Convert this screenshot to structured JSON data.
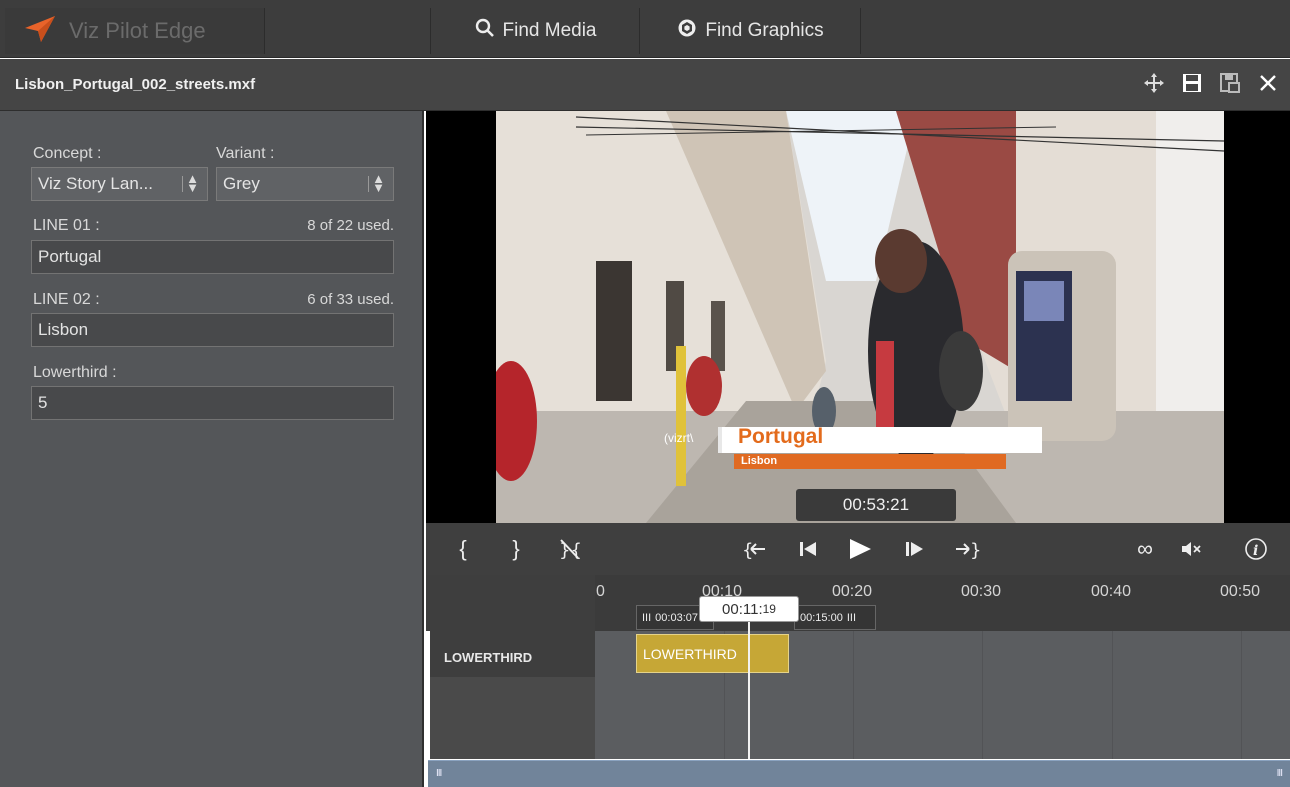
{
  "colors": {
    "accent_orange": "#e8632a",
    "clip_gold": "#c6a736",
    "panel_bg": "#545659",
    "nav_bg": "#3d3d3d",
    "lower_third_orange": "#e06a22",
    "scrollbar_blue": "#71849a"
  },
  "topnav": {
    "brand": "Viz Pilot Edge",
    "find_media": "Find Media",
    "find_graphics": "Find Graphics"
  },
  "titlebar": {
    "filename": "Lisbon_Portugal_002_streets.mxf",
    "icons": [
      "move-icon",
      "save-icon",
      "save-as-icon",
      "close-icon"
    ]
  },
  "form": {
    "concept_label": "Concept :",
    "concept_value": "Viz Story Lan...",
    "variant_label": "Variant :",
    "variant_value": "Grey",
    "line01_label": "LINE 01 :",
    "line01_usage": "8 of 22 used.",
    "line01_value": "Portugal",
    "line02_label": "LINE 02 :",
    "line02_usage": "6 of 33 used.",
    "line02_value": "Lisbon",
    "lowerthird_label": "Lowerthird :",
    "lowerthird_value": "5"
  },
  "video": {
    "overlay_title": "Portugal",
    "overlay_subtitle": "Lisbon",
    "overlay_logo": "(vizrt\\",
    "timecode": "00:53:21"
  },
  "transport": {
    "icons": [
      "mark-in-icon",
      "mark-out-icon",
      "clear-marks-icon",
      "go-to-in-icon",
      "step-back-icon",
      "play-icon",
      "step-forward-icon",
      "go-to-out-icon",
      "loop-icon",
      "mute-icon",
      "info-icon"
    ]
  },
  "timeline": {
    "ticks": [
      "0",
      "00:10",
      "00:20",
      "00:30",
      "00:40",
      "00:50"
    ],
    "track_name": "LOWERTHIRD",
    "clip_label": "LOWERTHIRD",
    "clip_in": "00:03:07",
    "clip_out": "00:15:00",
    "playhead_main": "00:11:",
    "playhead_frames": "19"
  }
}
